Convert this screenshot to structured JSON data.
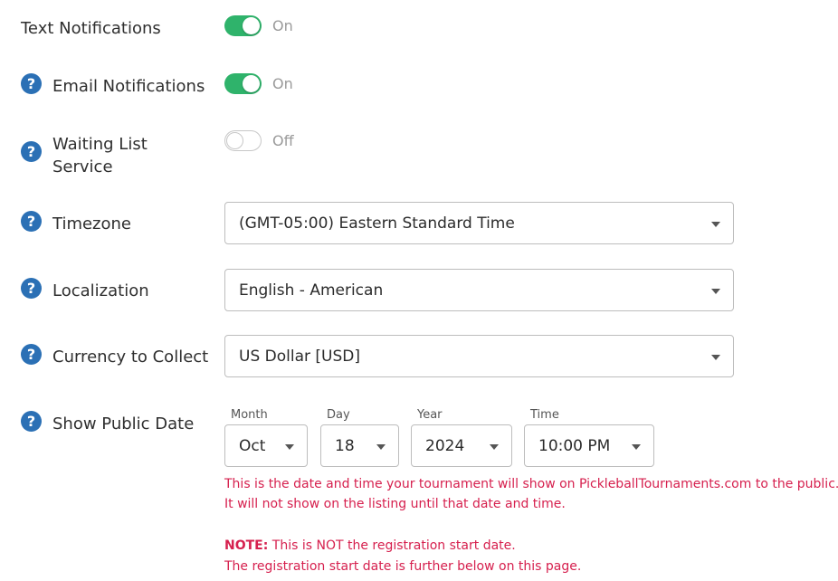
{
  "settings": {
    "text_notifications": {
      "label": "Text Notifications",
      "state": "On",
      "enabled": true
    },
    "email_notifications": {
      "label": "Email Notifications",
      "state": "On",
      "enabled": true
    },
    "waiting_list": {
      "label_line1": "Waiting List",
      "label_line2": "Service",
      "state": "Off",
      "enabled": false
    },
    "timezone": {
      "label": "Timezone",
      "value": "(GMT-05:00) Eastern Standard Time"
    },
    "localization": {
      "label": "Localization",
      "value": "English - American"
    },
    "currency": {
      "label": "Currency to Collect",
      "value": "US Dollar [USD]"
    },
    "public_date": {
      "label": "Show Public Date",
      "month": {
        "label": "Month",
        "value": "Oct"
      },
      "day": {
        "label": "Day",
        "value": "18"
      },
      "year": {
        "label": "Year",
        "value": "2024"
      },
      "time": {
        "label": "Time",
        "value": "10:00 PM"
      }
    }
  },
  "help_icon_glyph": "?",
  "notes": {
    "line1": "This is the date and time your tournament will show on PickleballTournaments.com to the public.",
    "line2": "It will not show on the listing until that date and time.",
    "note_prefix": "NOTE:",
    "note_text": " This is NOT the registration start date.",
    "line4": "The registration start date is further below on this page."
  },
  "colors": {
    "toggle_on": "#2fb36b",
    "help_icon": "#2b70b5",
    "note_text": "#d6204e"
  }
}
